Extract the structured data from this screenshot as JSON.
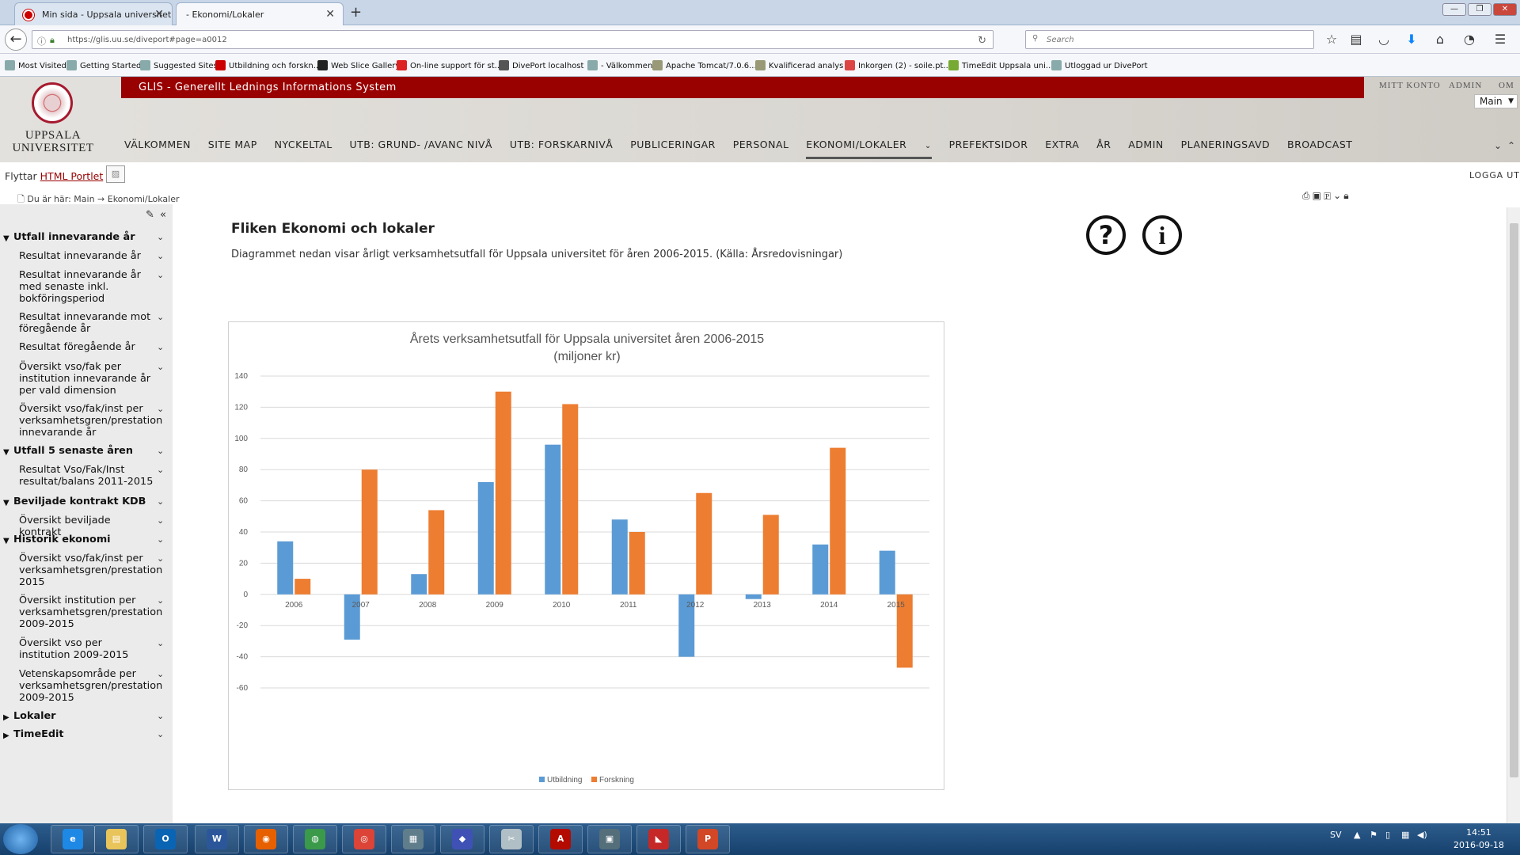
{
  "browser": {
    "tabs": [
      {
        "title": "Min sida - Uppsala universitet"
      },
      {
        "title": "- Ekonomi/Lokaler"
      }
    ],
    "url": "https://glis.uu.se/diveport#page=a0012",
    "search_placeholder": "Search",
    "bookmarks": [
      "Most Visited",
      "Getting Started",
      "Suggested Sites",
      "Utbildning och forskn...",
      "Web Slice Gallery",
      "On-line support för st...",
      "DivePort localhost",
      "- Välkommen",
      "Apache Tomcat/7.0.6...",
      "Kvalificerad analys",
      "Inkorgen (2) - soile.pt...",
      "TimeEdit Uppsala uni...",
      "Utloggad ur DivePort"
    ]
  },
  "site": {
    "logo_text": "UPPSALA UNIVERSITET",
    "system_name": "GLIS - Generellt Lednings Informations System",
    "top_links": [
      "MITT KONTO",
      "ADMIN",
      "OM"
    ],
    "main_select": "Main",
    "menu": [
      "VÄLKOMMEN",
      "SITE MAP",
      "NYCKELTAL",
      "UTB: GRUND- /AVANC NIVÅ",
      "UTB: FORSKARNIVÅ",
      "PUBLICERINGAR",
      "PERSONAL",
      "EKONOMI/LOKALER",
      "PREFEKTSIDOR",
      "EXTRA",
      "ÅR",
      "ADMIN",
      "PLANERINGSAVD",
      "BROADCAST"
    ],
    "active_menu": "EKONOMI/LOKALER",
    "flyttar_prefix": "Flyttar",
    "flyttar_link": "HTML Portlet",
    "logout": "LOGGA UT",
    "breadcrumb": "Du är här:  Main → Ekonomi/Lokaler"
  },
  "sidebar": {
    "items": [
      {
        "type": "section",
        "label": "Utfall innevarande år",
        "expanded": true
      },
      {
        "type": "sub",
        "label": "Resultat innevarande år"
      },
      {
        "type": "sub",
        "label": "Resultat innevarande år med senaste inkl. bokföringsperiod"
      },
      {
        "type": "sub",
        "label": "Resultat innevarande mot föregående år"
      },
      {
        "type": "sub",
        "label": "Resultat föregående år"
      },
      {
        "type": "sub",
        "label": "Översikt vso/fak per institution innevarande år per vald dimension"
      },
      {
        "type": "sub",
        "label": "Översikt vso/fak/inst per verksamhetsgren/prestation innevarande år"
      },
      {
        "type": "section",
        "label": "Utfall 5 senaste åren",
        "expanded": true
      },
      {
        "type": "sub",
        "label": "Resultat Vso/Fak/Inst resultat/balans 2011-2015"
      },
      {
        "type": "section",
        "label": "Beviljade kontrakt KDB",
        "expanded": true
      },
      {
        "type": "sub",
        "label": "Översikt beviljade kontrakt"
      },
      {
        "type": "section",
        "label": "Historik ekonomi",
        "expanded": true
      },
      {
        "type": "sub",
        "label": "Översikt vso/fak/inst per verksamhetsgren/prestation 2015"
      },
      {
        "type": "sub",
        "label": "Översikt institution per verksamhetsgren/prestation 2009-2015"
      },
      {
        "type": "sub",
        "label": "Översikt vso per institution 2009-2015"
      },
      {
        "type": "sub",
        "label": "Vetenskapsområde per verksamhetsgren/prestation 2009-2015"
      },
      {
        "type": "section",
        "label": "Lokaler",
        "expanded": false
      },
      {
        "type": "section",
        "label": "TimeEdit",
        "expanded": false
      }
    ]
  },
  "content": {
    "title": "Fliken Ekonomi och lokaler",
    "description": "Diagrammet nedan visar årligt verksamhetsutfall för Uppsala universitet för åren 2006-2015. (Källa: Årsredovisningar)",
    "help_icon": "?",
    "info_icon": "i"
  },
  "chart_data": {
    "type": "bar",
    "title_line1": "Årets verksamhetsutfall för Uppsala universitet åren 2006-2015",
    "title_line2": "(miljoner kr)",
    "categories": [
      "2006",
      "2007",
      "2008",
      "2009",
      "2010",
      "2011",
      "2012",
      "2013",
      "2014",
      "2015"
    ],
    "series": [
      {
        "name": "Utbildning",
        "color": "#5b9bd5",
        "values": [
          34,
          -29,
          13,
          72,
          96,
          48,
          -40,
          -3,
          32,
          28
        ]
      },
      {
        "name": "Forskning",
        "color": "#ed7d31",
        "values": [
          10,
          80,
          54,
          130,
          122,
          40,
          65,
          51,
          94,
          -47
        ]
      }
    ],
    "ylim": [
      -60,
      140
    ],
    "yticks": [
      140,
      120,
      100,
      80,
      60,
      40,
      20,
      0,
      -20,
      -40,
      -60
    ],
    "grid": true,
    "legend_position": "bottom"
  },
  "taskbar": {
    "apps": [
      {
        "name": "internet-explorer",
        "glyph": "e",
        "color": "#1e88e5"
      },
      {
        "name": "file-explorer",
        "glyph": "▤",
        "color": "#e8c45a"
      },
      {
        "name": "outlook",
        "glyph": "O",
        "color": "#0a64b4"
      },
      {
        "name": "word",
        "glyph": "W",
        "color": "#2b579a"
      },
      {
        "name": "firefox",
        "glyph": "◉",
        "color": "#e66000"
      },
      {
        "name": "network",
        "glyph": "◍",
        "color": "#3a9a4a"
      },
      {
        "name": "chrome",
        "glyph": "◎",
        "color": "#db4437"
      },
      {
        "name": "notepad",
        "glyph": "▦",
        "color": "#607d8b"
      },
      {
        "name": "cube-app",
        "glyph": "◆",
        "color": "#3f51b5"
      },
      {
        "name": "snipping-tool",
        "glyph": "✂",
        "color": "#b0bec5"
      },
      {
        "name": "acrobat",
        "glyph": "A",
        "color": "#b30b00"
      },
      {
        "name": "remote-desktop",
        "glyph": "▣",
        "color": "#546e7a"
      },
      {
        "name": "diveport",
        "glyph": "◣",
        "color": "#c62828"
      },
      {
        "name": "powerpoint",
        "glyph": "P",
        "color": "#d24726"
      }
    ],
    "language": "SV",
    "time": "14:51",
    "date": "2016-09-18"
  }
}
